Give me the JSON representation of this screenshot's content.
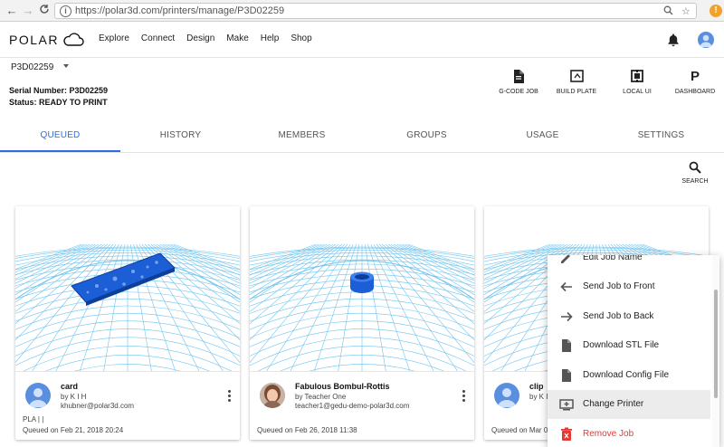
{
  "browser": {
    "back": "←",
    "forward": "→",
    "reload": "C",
    "url": "https://polar3d.com/printers/manage/P3D02259",
    "zoom_icon": "magnifier-icon",
    "star_icon": "star-icon",
    "extension_badge": "!"
  },
  "header": {
    "logo_text": "POLAR",
    "menu": [
      "Explore",
      "Connect",
      "Design",
      "Make",
      "Help",
      "Shop"
    ]
  },
  "printer": {
    "selected": "P3D02259",
    "serial_label": "Serial Number: P3D02259",
    "status_label": "Status: READY TO PRINT"
  },
  "actions": [
    {
      "label": "G-CODE JOB",
      "icon": "file-icon"
    },
    {
      "label": "BUILD PLATE",
      "icon": "build-plate-icon"
    },
    {
      "label": "LOCAL UI",
      "icon": "local-ui-icon"
    },
    {
      "label": "DASHBOARD",
      "icon": "dashboard-icon"
    }
  ],
  "dashboard_glyph": "P",
  "tabs": [
    "QUEUED",
    "HISTORY",
    "MEMBERS",
    "GROUPS",
    "USAGE",
    "SETTINGS"
  ],
  "active_tab": "QUEUED",
  "search_label": "SEARCH",
  "cards": [
    {
      "title": "card",
      "by": "by K I H",
      "email": "khubner@polar3d.com",
      "material": "PLA | |",
      "queued": "Queued on Feb 21, 2018 20:24"
    },
    {
      "title": "Fabulous Bombul-Rottis",
      "by": "by Teacher One",
      "email": "teacher1@gedu-demo-polar3d.com",
      "material": "",
      "queued": "Queued on Feb 26, 2018 11:38"
    },
    {
      "title": "clip",
      "by": "by K I",
      "email": "",
      "material": "",
      "queued": "Queued on Mar 0"
    }
  ],
  "context_menu": {
    "items": [
      {
        "label": "Edit Job Name",
        "icon": "pencil-icon"
      },
      {
        "label": "Send Job to Front",
        "icon": "arrow-left-icon"
      },
      {
        "label": "Send Job to Back",
        "icon": "arrow-right-icon"
      },
      {
        "label": "Download STL File",
        "icon": "file-icon"
      },
      {
        "label": "Download Config File",
        "icon": "file-icon"
      },
      {
        "label": "Change Printer",
        "icon": "printer-swap-icon"
      },
      {
        "label": "Remove Job",
        "icon": "trash-icon"
      }
    ],
    "highlighted": "Change Printer"
  },
  "colors": {
    "accent": "#2d6fd8",
    "grid": "#6fc3ee",
    "model": "#1b5ed6",
    "danger": "#e53935"
  }
}
